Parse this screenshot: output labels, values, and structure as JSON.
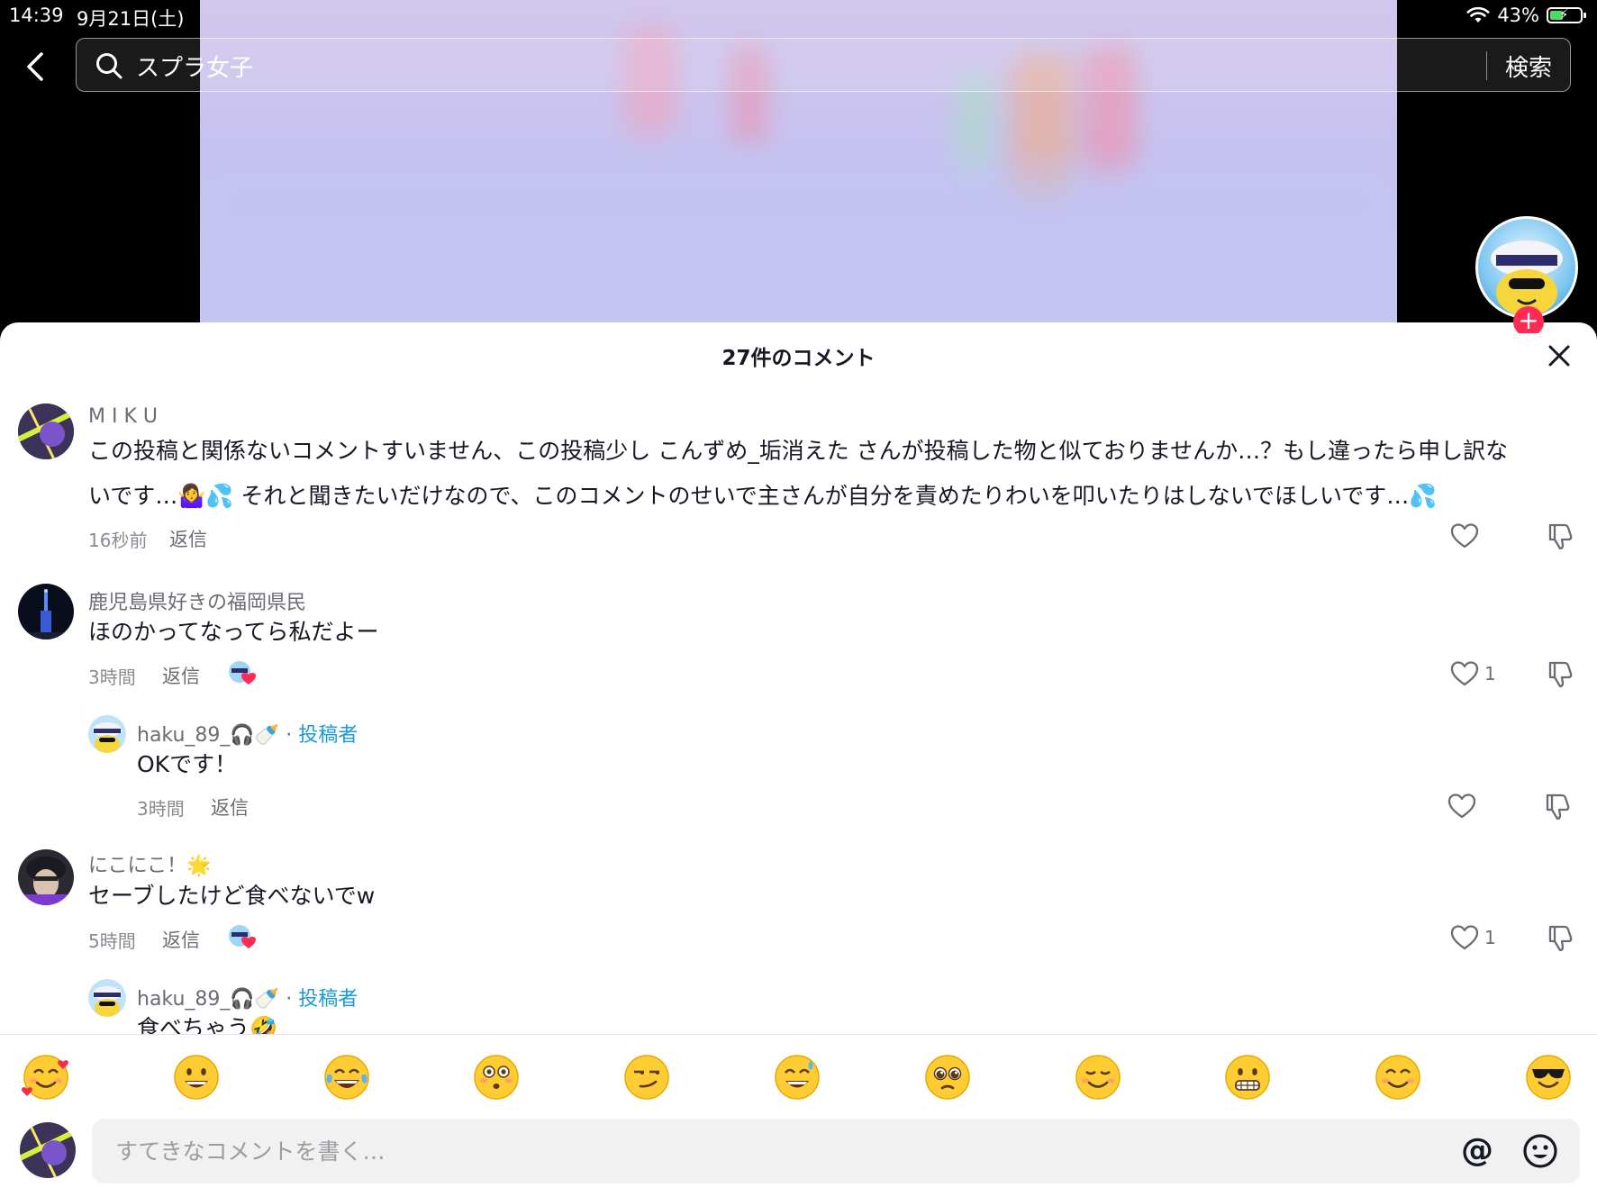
{
  "status_bar": {
    "time": "14:39",
    "date": "9月21日(土)",
    "battery": "43%",
    "battery_level": 0.43
  },
  "search": {
    "query": "スプラ女子",
    "button_label": "検索"
  },
  "sheet": {
    "title": "27件のコメント"
  },
  "comments": [
    {
      "username": "M I K U",
      "text_line1": "この投稿と関係ないコメントすいません、この投稿少し こんずめ_垢消えた さんが投稿した物と似ておりませんか…？もし違ったら申し訳な",
      "text_line2": "いです…🤷‍♀️💦 それと聞きたいだけなので、このコメントのせいで主さんが自分を責めたりわいを叩いたりはしないでほしいです…💦",
      "time": "16秒前",
      "reply_label": "返信"
    },
    {
      "username": "鹿児島県好きの福岡県民",
      "text": "ほのかってなってら私だよー",
      "time": "3時間",
      "reply_label": "返信",
      "likes": "1"
    },
    {
      "username": "haku_89_🎧🍼",
      "author_tag": "投稿者",
      "separator": "·",
      "text": "OKです！",
      "time": "3時間",
      "reply_label": "返信"
    },
    {
      "username": "にこにこ！🌟",
      "text": "セーブしたけど食べないでw",
      "time": "5時間",
      "reply_label": "返信",
      "likes": "1"
    },
    {
      "username": "haku_89_🎧🍼",
      "author_tag": "投稿者",
      "separator": "·",
      "text": "食べちゃう🤣"
    }
  ],
  "emoji_bar": [
    "smiling-face-with-hearts-icon",
    "grinning-face-icon",
    "face-with-tears-of-joy-icon",
    "flushed-face-icon",
    "smirking-face-icon",
    "grinning-sweat-icon",
    "pleading-face-icon",
    "relieved-face-icon",
    "grimacing-face-icon",
    "smiling-face-icon",
    "sunglasses-face-icon"
  ],
  "composer": {
    "placeholder": "すてきなコメントを書く…",
    "mention_label": "@"
  },
  "colors": {
    "accent": "#fe2c55",
    "author_tag": "#1a9bd7",
    "sheet_bg": "#ffffff"
  }
}
